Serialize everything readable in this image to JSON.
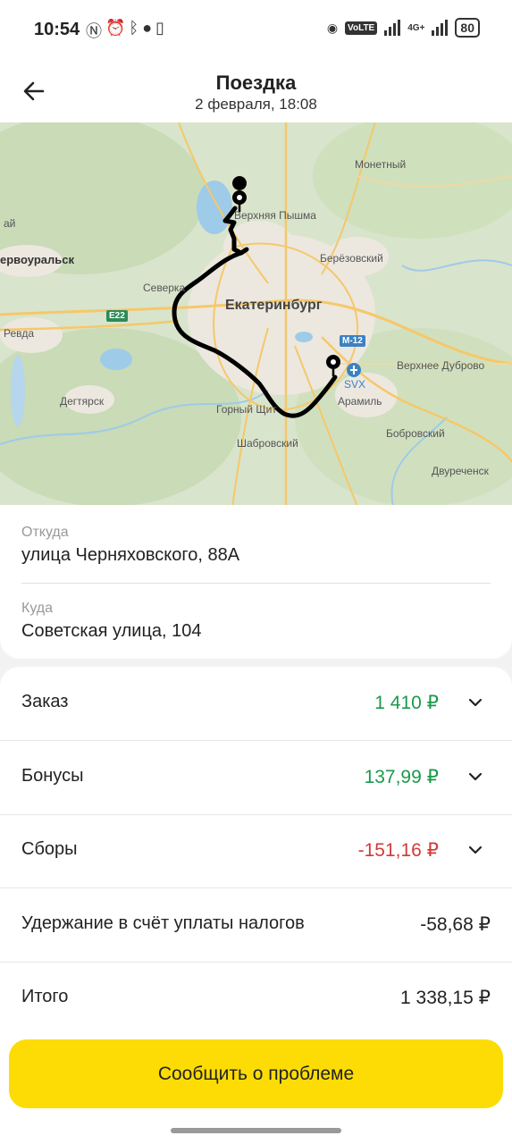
{
  "status_bar": {
    "time": "10:54",
    "left_icons": [
      "nfc-icon",
      "alarm-icon",
      "bluetooth-battery-icon",
      "location-icon",
      "vibrate-icon"
    ],
    "volte": "VoLTE",
    "network": "4G+",
    "battery": "80"
  },
  "header": {
    "title": "Поездка",
    "subtitle": "2 февраля, 18:08"
  },
  "map": {
    "labels": {
      "monetny": "Монетный",
      "verkhnyaya_pyshma": "Верхняя Пышма",
      "pervouralsk": "ервоуральск",
      "berezovsky": "Берёзовский",
      "severka": "Северка",
      "ekaterinburg": "Екатеринбург",
      "revda": "Ревда",
      "degtyarsk": "Дегтярск",
      "gorny_shchit": "Горный Щит",
      "aramil": "Арамиль",
      "shabrovsky": "Шабровский",
      "verkhnee_dubrovo": "Верхнее Дуброво",
      "bobrovsky": "Бобровский",
      "dvurechensk": "Двуреченск",
      "svx": "SVX",
      "m12": "М-12",
      "e22": "E22",
      "small": "ай"
    }
  },
  "from": {
    "label": "Откуда",
    "value": "улица Черняховского, 88А"
  },
  "to": {
    "label": "Куда",
    "value": "Советская улица, 104"
  },
  "money": {
    "order": {
      "label": "Заказ",
      "amount": "1 410 ₽",
      "color": "#1a9a4a"
    },
    "bonuses": {
      "label": "Бонусы",
      "amount": "137,99 ₽",
      "color": "#1a9a4a"
    },
    "fees": {
      "label": "Сборы",
      "amount": "-151,16 ₽",
      "color": "#d23a3a"
    },
    "tax": {
      "label": "Удержание в счёт уплаты налогов",
      "amount": "-58,68 ₽"
    },
    "total": {
      "label": "Итого",
      "amount": "1 338,15 ₽"
    }
  },
  "report_button": "Сообщить о проблеме"
}
